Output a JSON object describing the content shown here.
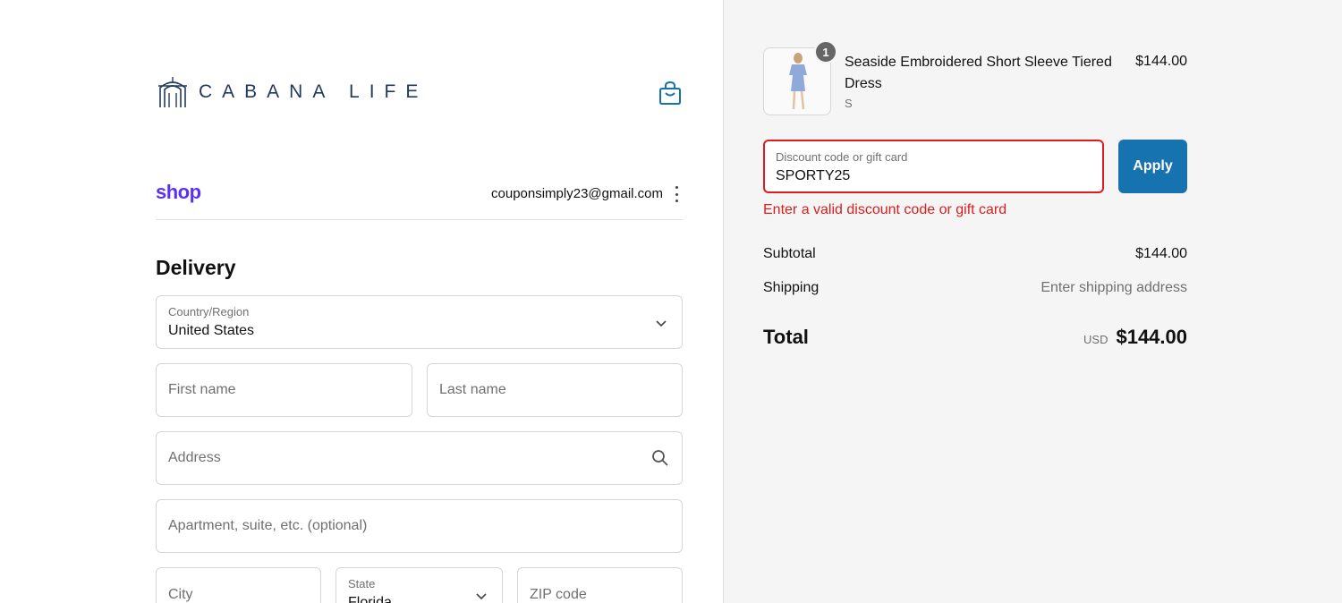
{
  "brand": {
    "logo_text": "CABANA LIFE",
    "logo_icon": "cabana-arch-icon",
    "accent": "#233a5e"
  },
  "header": {
    "cart_icon": "shopping-bag-icon"
  },
  "shop_pay": {
    "logo": "shop",
    "email": "couponsimply23@gmail.com",
    "menu_icon": "kebab-menu-icon",
    "color": "#5a31f4"
  },
  "delivery": {
    "title": "Delivery",
    "country": {
      "label": "Country/Region",
      "value": "United States"
    },
    "first_name": {
      "placeholder": "First name"
    },
    "last_name": {
      "placeholder": "Last name"
    },
    "address": {
      "placeholder": "Address"
    },
    "apartment": {
      "placeholder": "Apartment, suite, etc. (optional)"
    },
    "city": {
      "placeholder": "City"
    },
    "state": {
      "label": "State",
      "value": "Florida"
    },
    "zip": {
      "placeholder": "ZIP code"
    }
  },
  "order": {
    "item": {
      "quantity": "1",
      "name": "Seaside Embroidered Short Sleeve Tiered Dress",
      "variant": "S",
      "price": "$144.00"
    },
    "discount": {
      "label": "Discount code or gift card",
      "value": "SPORTY25",
      "apply_label": "Apply",
      "error": "Enter a valid discount code or gift card"
    },
    "subtotal": {
      "label": "Subtotal",
      "value": "$144.00"
    },
    "shipping": {
      "label": "Shipping",
      "value": "Enter shipping address"
    },
    "total": {
      "label": "Total",
      "currency": "USD",
      "value": "$144.00"
    }
  },
  "colors": {
    "primary_button": "#1773b0",
    "error": "#dd1d1d",
    "summary_bg": "#f5f5f5"
  }
}
